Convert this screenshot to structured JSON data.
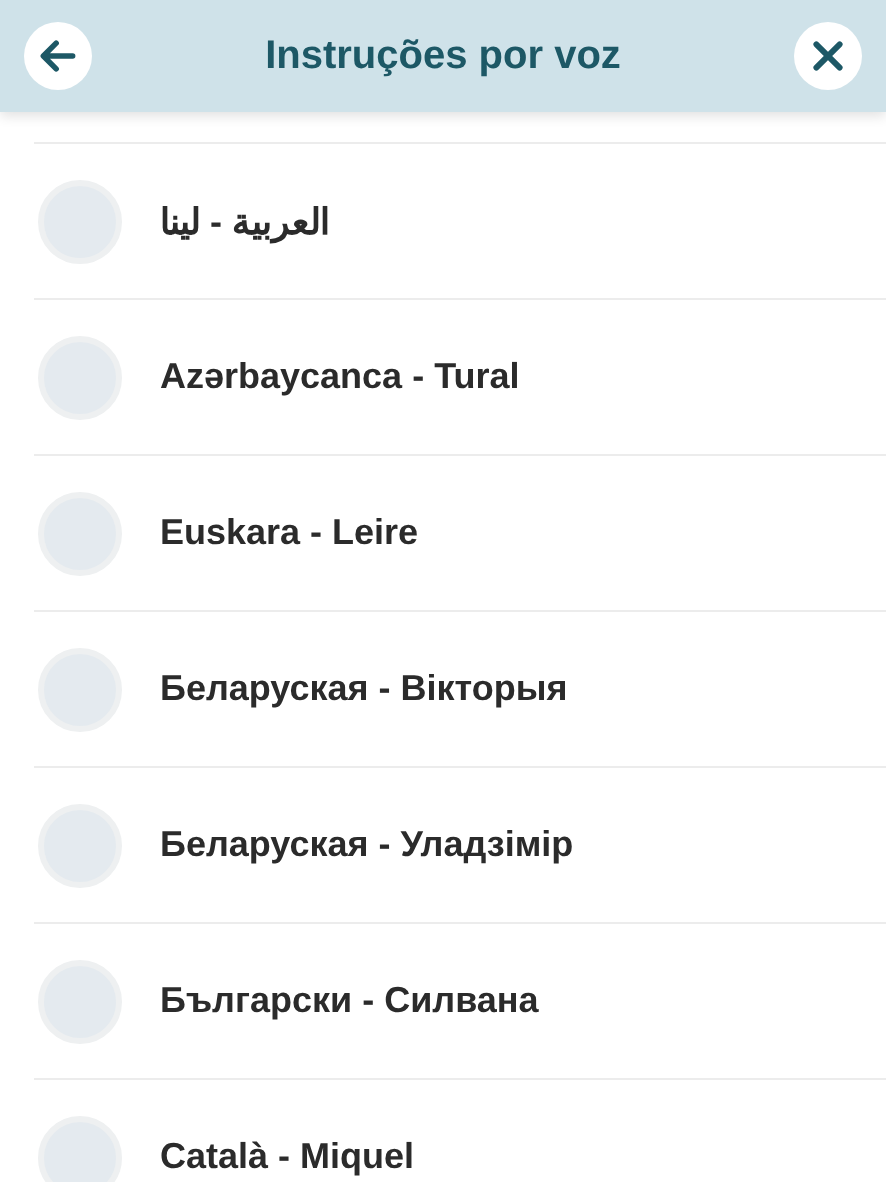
{
  "header": {
    "title": "Instruções por voz"
  },
  "voices": [
    {
      "label": "العربية - لينا",
      "selected": false
    },
    {
      "label": "Azərbaycanca - Tural",
      "selected": false
    },
    {
      "label": "Euskara - Leire",
      "selected": false
    },
    {
      "label": "Беларуская - Вікторыя",
      "selected": false
    },
    {
      "label": "Беларуская - Уладзімір",
      "selected": false
    },
    {
      "label": "Български - Силвана",
      "selected": false
    },
    {
      "label": "Català - Miquel",
      "selected": false
    }
  ]
}
